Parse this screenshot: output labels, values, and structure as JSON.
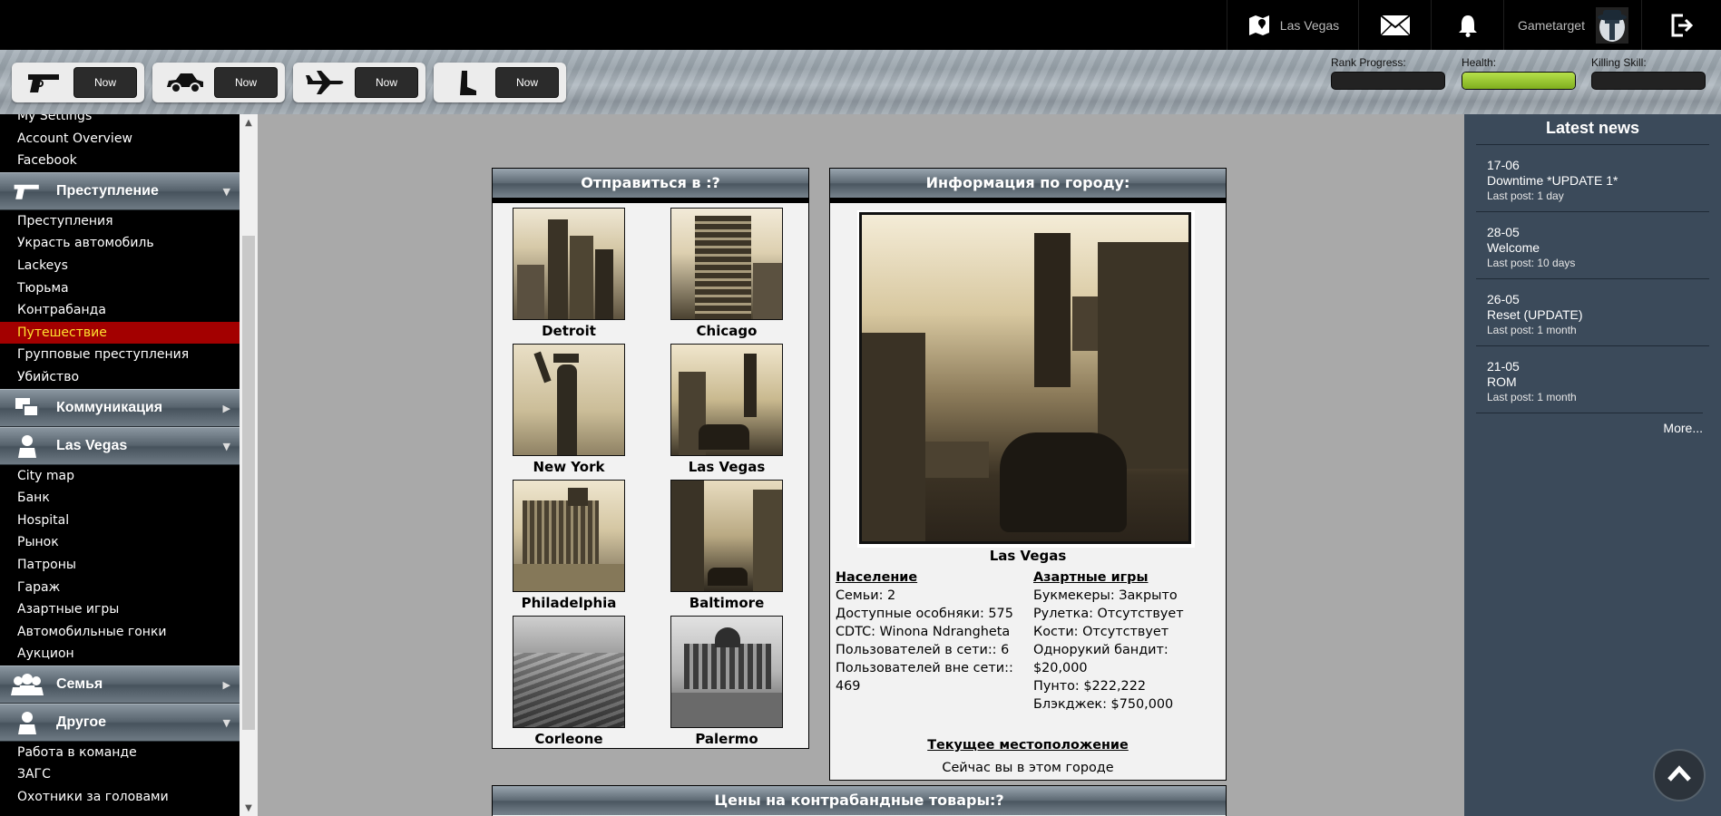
{
  "topbar": {
    "location": "Las Vegas",
    "username": "Gametarget"
  },
  "timers": [
    {
      "icon": "pistol-icon",
      "label": "Now"
    },
    {
      "icon": "car-icon",
      "label": "Now"
    },
    {
      "icon": "airplane-icon",
      "label": "Now"
    },
    {
      "icon": "boot-icon",
      "label": "Now"
    }
  ],
  "stats": {
    "rank_label": "Rank Progress:",
    "rank_progress": 0,
    "health_label": "Health:",
    "health": 100,
    "killing_label": "Killing Skill:",
    "killing_skill": 0
  },
  "sidebar": {
    "top_links": [
      "My Settings",
      "Account Overview",
      "Facebook"
    ],
    "crime_title": "Преступление",
    "crime_links": [
      "Преступления",
      "Украсть автомобиль",
      "Lackeys",
      "Тюрьма",
      "Контрабанда",
      "Путешествие",
      "Групповые преступления",
      "Убийство"
    ],
    "comm_title": "Коммуникация",
    "city_title": "Las Vegas",
    "city_links": [
      "City map",
      "Банк",
      "Hospital",
      "Рынок",
      "Патроны",
      "Гараж",
      "Азартные игры",
      "Автомобильные гонки",
      "Аукцион"
    ],
    "family_title": "Семья",
    "other_title": "Другое",
    "other_links": [
      "Работа в команде",
      "ЗАГС",
      "Охотники за головами"
    ]
  },
  "travel": {
    "title": "Отправиться в :",
    "help": "?",
    "cities": [
      "Detroit",
      "Chicago",
      "New York",
      "Las Vegas",
      "Philadelphia",
      "Baltimore",
      "Corleone",
      "Palermo"
    ]
  },
  "info": {
    "title": "Информация по городу:",
    "city_name": "Las Vegas",
    "population_heading": "Население",
    "families": "Семьи: 2",
    "mansions": "Доступные особняки: 575",
    "cdtc": "CDTC: Winona Ndrangheta",
    "online": "Пользователей в сети:: 6",
    "offline": "Пользователей вне сети:: 469",
    "gambling_heading": "Азартные игры",
    "bookmakers": "Букмекеры: Закрыто",
    "roulette": "Рулетка: Отсутствует",
    "dice": "Кости: Отсутствует",
    "slots": "Однорукий бандит: $20,000",
    "punto": "Пунто: $222,222",
    "blackjack": "Блэкджек: $750,000",
    "current_heading": "Текущее местоположение",
    "current_text": "Сейчас вы в этом городе"
  },
  "prices": {
    "title": "Цены на контрабандные товары:",
    "help": "?"
  },
  "news": {
    "title": "Latest news",
    "items": [
      {
        "date": "17-06",
        "headline": "Downtime *UPDATE 1*",
        "meta": "Last post: 1 day"
      },
      {
        "date": "28-05",
        "headline": "Welcome",
        "meta": "Last post: 10 days"
      },
      {
        "date": "26-05",
        "headline": "Reset (UPDATE)",
        "meta": "Last post: 1 month"
      },
      {
        "date": "21-05",
        "headline": "ROM",
        "meta": "Last post: 1 month"
      }
    ],
    "more": "More..."
  }
}
